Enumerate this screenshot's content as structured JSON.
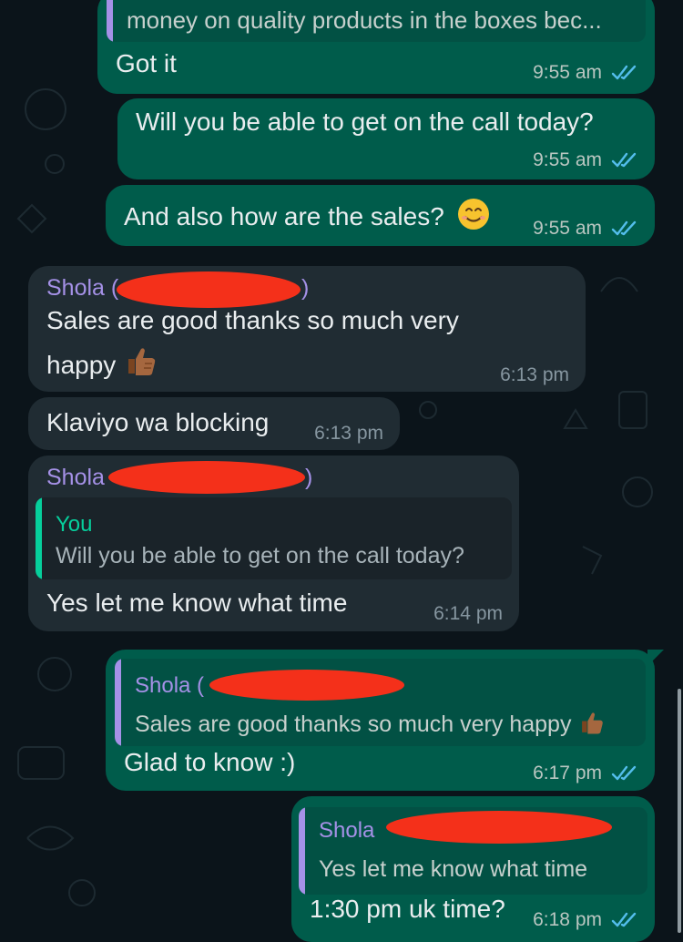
{
  "messages": [
    {
      "quote_text": "money on quality products in the boxes bec...",
      "text": "Got it",
      "time": "9:55 am"
    },
    {
      "text": "Will you be able to get on the call today?",
      "time": "9:55 am"
    },
    {
      "text": "And also how are the sales?",
      "time": "9:55 am"
    },
    {
      "sender": "Shola (",
      "sender_close": ")",
      "line1": "Sales are good thanks so much very",
      "line2": "happy",
      "time": "6:13 pm"
    },
    {
      "text": "Klaviyo wa blocking",
      "time": "6:13 pm"
    },
    {
      "sender": "Shola",
      "sender_close": ")",
      "quote_name": "You",
      "quote_text": "Will you be able to get on the call today?",
      "text": "Yes let me know what time",
      "time": "6:14 pm"
    },
    {
      "quote_name": "Shola (",
      "quote_text": "Sales are good thanks so much very happy",
      "text": "Glad to know :)",
      "time": "6:17 pm"
    },
    {
      "quote_name": "Shola",
      "quote_text": "Yes let me know what time",
      "text": "1:30 pm uk time?",
      "time": "6:18 pm"
    }
  ],
  "colors": {
    "background": "#0b141a",
    "outgoing_bubble": "#005c4b",
    "incoming_bubble": "#202c33",
    "read_ticks": "#53bdeb",
    "sender_name": "#a591e7",
    "quote_you": "#06cf9c",
    "redaction": "#f4301a"
  },
  "icons": [
    "double-check-icon",
    "smiling-face-emoji",
    "thumbs-up-emoji"
  ]
}
